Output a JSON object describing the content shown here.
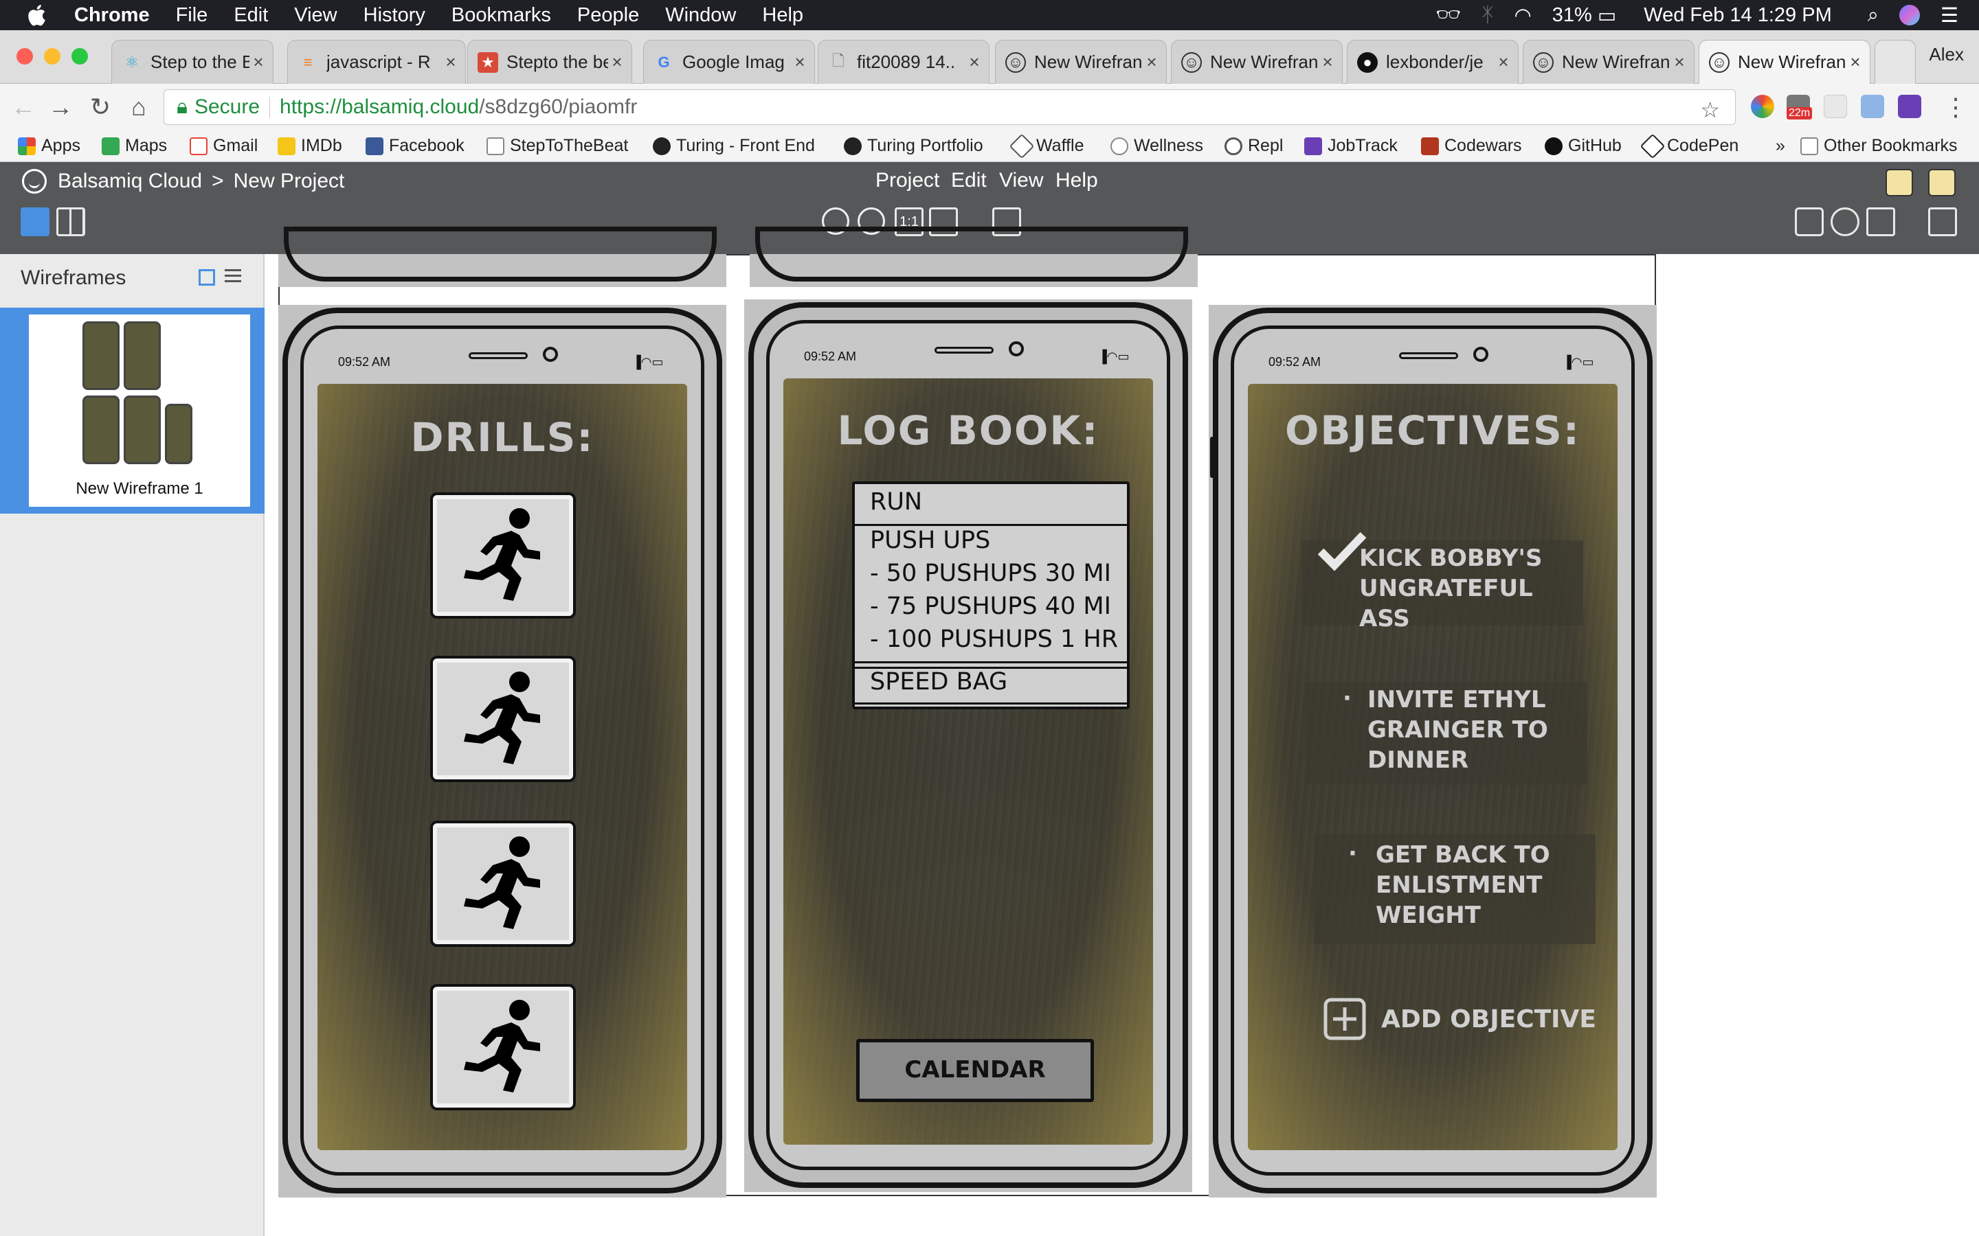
{
  "menubar": {
    "app": "Chrome",
    "items": [
      "File",
      "Edit",
      "View",
      "History",
      "Bookmarks",
      "People",
      "Window",
      "Help"
    ],
    "battery": "31%",
    "datetime": "Wed Feb 14  1:29 PM"
  },
  "tabs": [
    {
      "label": "Step to the B",
      "icon": "react-icon",
      "color": "#61dafb"
    },
    {
      "label": "javascript - R",
      "icon": "stackoverflow-icon",
      "color": "#f48024"
    },
    {
      "label": "Stepto the be",
      "icon": "bookmark-red-icon",
      "color": "#d94a38"
    },
    {
      "label": "Google Imag",
      "icon": "google-icon",
      "color": "#4285f4"
    },
    {
      "label": "fit20089 14..",
      "icon": "document-icon",
      "color": "#777777"
    },
    {
      "label": "New Wirefran",
      "icon": "balsamiq-icon",
      "color": "#555555"
    },
    {
      "label": "New Wirefran",
      "icon": "balsamiq-icon",
      "color": "#555555"
    },
    {
      "label": "lexbonder/je",
      "icon": "github-icon",
      "color": "#111111"
    },
    {
      "label": "New Wirefran",
      "icon": "balsamiq-icon",
      "color": "#555555"
    },
    {
      "label": "New Wirefran",
      "icon": "balsamiq-icon",
      "color": "#555555",
      "active": true
    }
  ],
  "profile_name": "Alex",
  "address": {
    "secure_label": "Secure",
    "url_host": "https://balsamiq.cloud",
    "url_path": "/s8dzg60/piaomfr"
  },
  "extension_badge": "22m",
  "bookmarks": [
    {
      "label": "Apps",
      "color": "#e94235"
    },
    {
      "label": "Maps",
      "color": "#34a853"
    },
    {
      "label": "Gmail",
      "color": "#ea4335"
    },
    {
      "label": "IMDb",
      "color": "#f5c518"
    },
    {
      "label": "Facebook",
      "color": "#3b5998"
    },
    {
      "label": "StepToTheBeat",
      "color": "#9a9a9a"
    },
    {
      "label": "Turing - Front End",
      "color": "#222222"
    },
    {
      "label": "Turing Portfolio",
      "color": "#222222"
    },
    {
      "label": "Waffle",
      "color": "#555555"
    },
    {
      "label": "Wellness",
      "color": "#888888"
    },
    {
      "label": "Repl",
      "color": "#555555"
    },
    {
      "label": "JobTrack",
      "color": "#6a3fb5"
    },
    {
      "label": "Codewars",
      "color": "#b1361e"
    },
    {
      "label": "GitHub",
      "color": "#111111"
    },
    {
      "label": "CodePen",
      "color": "#222222"
    }
  ],
  "bookmarks_overflow": "»",
  "other_bookmarks": "Other Bookmarks",
  "balsamiq": {
    "breadcrumb_root": "Balsamiq Cloud",
    "breadcrumb_sep": ">",
    "breadcrumb_project": "New Project",
    "menu": [
      "Project",
      "Edit",
      "View",
      "Help"
    ],
    "zoom_reset": "1:1"
  },
  "sidebar": {
    "title": "Wireframes",
    "items": [
      {
        "label": "New Wireframe 1",
        "selected": true
      }
    ]
  },
  "phones": {
    "time": "09:52 AM",
    "drills": {
      "heading": "DRILLS:",
      "buttons": 4
    },
    "logbook": {
      "heading": "LOG BOOK:",
      "rows": [
        "RUN",
        "PUSH UPS",
        "- 50 PUSHUPS 30 MI",
        "- 75 PUSHUPS 40 MI",
        "- 100 PUSHUPS 1 HR",
        "SPEED BAG"
      ],
      "calendar_button": "CALENDAR"
    },
    "objectives": {
      "heading": "OBJECTIVES:",
      "items": [
        {
          "lines": [
            "KICK BOBBY'S",
            "UNGRATEFUL",
            "ASS"
          ],
          "checked": true
        },
        {
          "lines": [
            "INVITE ETHYL",
            "GRAINGER TO",
            "DINNER"
          ],
          "checked": false
        },
        {
          "lines": [
            "GET BACK TO",
            "ENLISTMENT",
            "WEIGHT"
          ],
          "checked": false
        }
      ],
      "add_label": "ADD OBJECTIVE"
    }
  }
}
